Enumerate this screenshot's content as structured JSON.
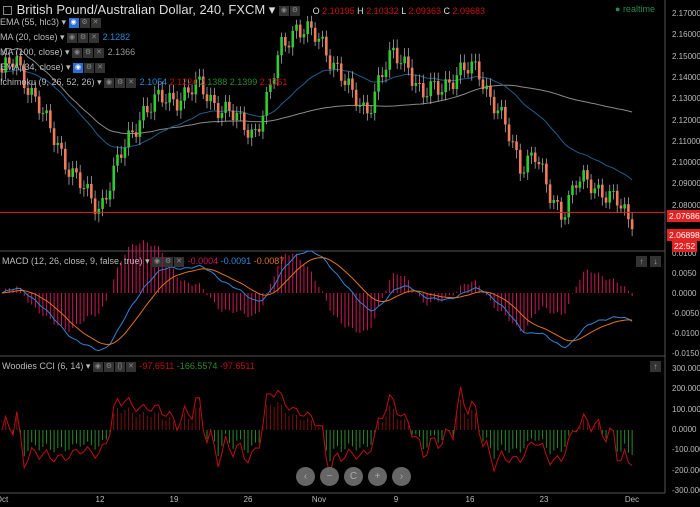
{
  "header": {
    "title": "British Pound/Australian Dollar, 240, FXCM",
    "o_label": "O",
    "o": "2.10195",
    "h_label": "H",
    "h": "2.10332",
    "l_label": "L",
    "l": "2.09363",
    "c_label": "C",
    "c": "2.09683",
    "status": "realtime"
  },
  "indicators": [
    {
      "name": "EMA (55, hlc3)",
      "values": []
    },
    {
      "name": "MA (20, close)",
      "values": [
        "2.1282"
      ]
    },
    {
      "name": "MA (100, close)",
      "values": [
        "2.1366"
      ]
    },
    {
      "name": "EMA (34, close)",
      "values": []
    },
    {
      "name": "Ichimoku (9, 26, 52, 26)",
      "values": [
        "2.1054",
        "2.1224",
        "2.1388",
        "2.1399",
        "2.1361"
      ]
    }
  ],
  "macd": {
    "name": "MACD (12, 26, close, 9, false, true)",
    "hist": "-0.0004",
    "macd": "-0.0091",
    "signal": "-0.0087",
    "axis": [
      "0.0100",
      "0.0050",
      "0.0000",
      "-0.0050",
      "-0.0100",
      "-0.0150"
    ]
  },
  "cci": {
    "name": "Woodies CCI (6, 14)",
    "v1": "-97.6511",
    "v2": "-166.5574",
    "v3": "-97.6511",
    "axis": [
      "300.0000",
      "200.0000",
      "100.0000",
      "0.0000",
      "-100.0000",
      "-200.0000",
      "-300.0000"
    ]
  },
  "price_axis": [
    "2.17000",
    "2.16000",
    "2.15000",
    "2.14000",
    "2.13000",
    "2.12000",
    "2.11000",
    "2.10000",
    "2.09000",
    "2.08000"
  ],
  "price_line": "2.07686",
  "last_price": "2.06898",
  "countdown": "22:52",
  "x_axis": [
    "Oct",
    "12",
    "19",
    "26",
    "Nov",
    "9",
    "16",
    "23",
    "Dec"
  ],
  "nav": [
    "‹",
    "−",
    "C",
    "+",
    "›"
  ],
  "colors": {
    "up": "#2ecc2e",
    "down": "#f07a5a",
    "ema55": "#8a8a8a",
    "ma100": "#1e5f88",
    "macd": "#2f86d6",
    "signal": "#e0741a",
    "hist": "#d0155c",
    "cci_up": "#2a8a2a",
    "cci_line": "#c01010",
    "price_line": "#e32222"
  },
  "chart_data": {
    "type": "candlestick",
    "title": "British Pound/Australian Dollar, 240, FXCM",
    "ylim": [
      2.065,
      2.175
    ],
    "close_path": [
      2.14,
      2.15,
      2.135,
      2.12,
      2.11,
      2.095,
      2.085,
      2.08,
      2.095,
      2.11,
      2.125,
      2.128,
      2.13,
      2.133,
      2.135,
      2.13,
      2.125,
      2.118,
      2.115,
      2.13,
      2.155,
      2.165,
      2.16,
      2.155,
      2.145,
      2.13,
      2.125,
      2.14,
      2.15,
      2.148,
      2.13,
      2.135,
      2.14,
      2.142,
      2.145,
      2.13,
      2.115,
      2.1,
      2.105,
      2.085,
      2.078,
      2.09,
      2.09,
      2.088,
      2.08,
      2.069
    ]
  }
}
